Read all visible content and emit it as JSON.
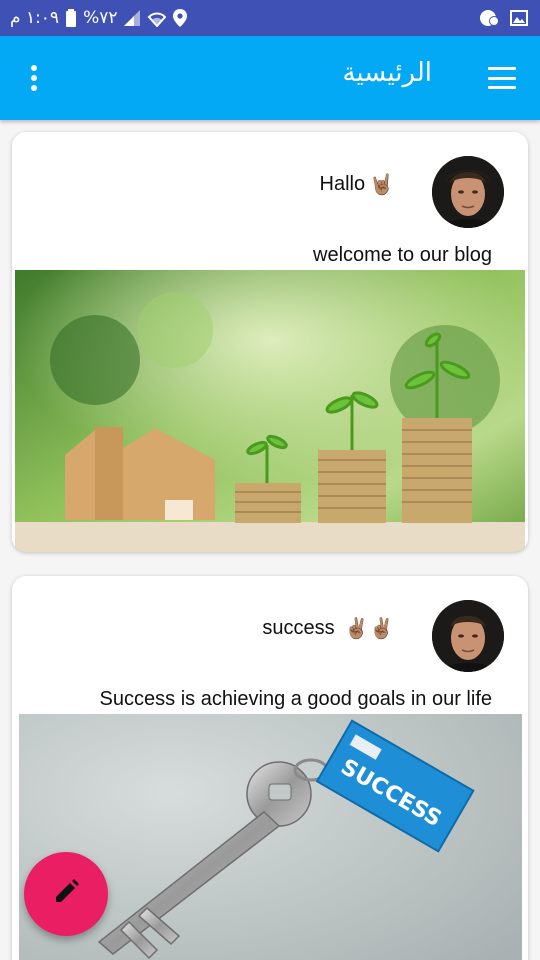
{
  "status_bar": {
    "time": "١:٠٩ م",
    "battery": "%٧٢",
    "icons": [
      "location-icon",
      "wifi-icon",
      "signal-icon",
      "battery-icon",
      "image-icon",
      "notification-icon"
    ]
  },
  "app_bar": {
    "title": "الرئيسية",
    "background": "#03a9f4",
    "menu_icon": "hamburger-menu-icon",
    "overflow_icon": "more-vertical-icon"
  },
  "posts": [
    {
      "title": "Hallo",
      "title_emoji": "🤘🏽",
      "body": "welcome to our blog",
      "image": "house-and-coins-photo"
    },
    {
      "title": "success",
      "title_emoji": "✌🏽✌🏽",
      "body": "Success is achieving a good goals in our life",
      "image": "key-with-success-tag-photo",
      "image_tag_text": "SUCCESS"
    }
  ],
  "fab": {
    "icon": "pencil-icon",
    "color": "#e91e63"
  }
}
